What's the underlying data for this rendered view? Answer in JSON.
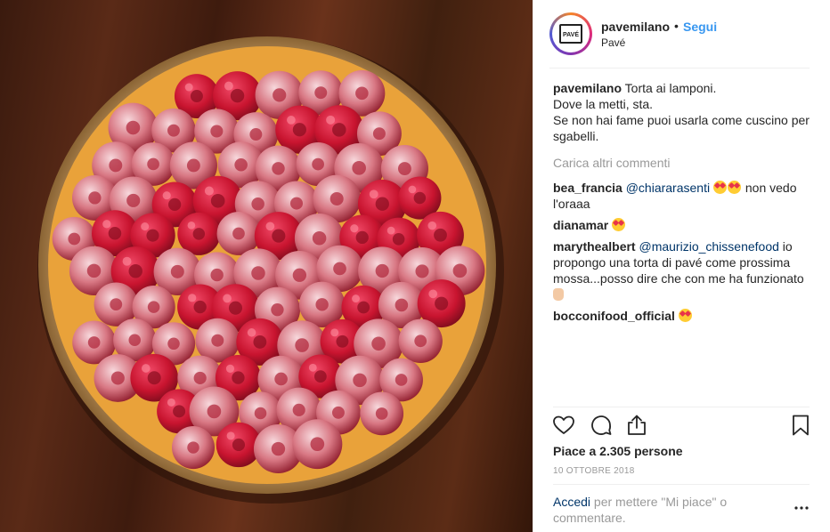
{
  "header": {
    "username": "pavemilano",
    "separator": "•",
    "follow_label": "Segui",
    "location": "Pavé",
    "avatar_text": "PAVÉ"
  },
  "caption": {
    "username": "pavemilano",
    "lines": [
      "Torta ai lamponi.",
      "Dove la metti, sta.",
      "Se non hai fame puoi usarla come cuscino per sgabelli."
    ]
  },
  "load_more": "Carica altri commenti",
  "comments": [
    {
      "username": "bea_francia",
      "mention": "@chiararasenti",
      "emoji": "heart-eyes-emoji",
      "text_after": "non vedo l'oraaa"
    },
    {
      "username": "dianamar",
      "emoji": "heart-eyes-emoji"
    },
    {
      "username": "marythealbert",
      "mention": "@maurizio_chissenefood",
      "text": "io propongo una torta di pavé come prossima mossa...posso dire che con me ha funzionato",
      "emoji": "hand-emoji"
    },
    {
      "username": "bocconifood_official",
      "emoji": "heart-eyes-emoji"
    }
  ],
  "actions": {
    "like": "heart-icon",
    "comment": "comment-icon",
    "share": "share-icon",
    "save": "bookmark-icon"
  },
  "likes_text": "Piace a 2.305 persone",
  "date_text": "10 OTTOBRE 2018",
  "login_prompt": {
    "link_text": "Accedi",
    "text": "per mettere \"Mi piace\" o commentare."
  },
  "more_icon": "more-dots-icon",
  "colors": {
    "accent_blue": "#3897f0",
    "link_dark": "#003569",
    "muted": "#999999",
    "raspberry": "#d41e3c"
  }
}
